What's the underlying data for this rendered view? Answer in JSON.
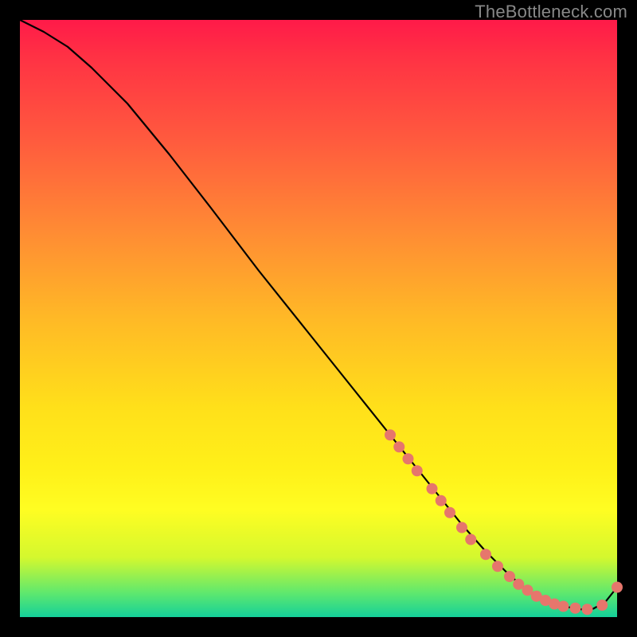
{
  "watermark": "TheBottleneck.com",
  "colors": {
    "background": "#000000",
    "curve_stroke": "#000000",
    "marker_fill": "#e6766c",
    "marker_stroke": "#d85e56",
    "gradient_top": "#ff1a49",
    "gradient_mid1": "#ffb926",
    "gradient_mid2": "#fffd22",
    "gradient_bottom": "#14d09a"
  },
  "chart_data": {
    "type": "line",
    "title": "",
    "xlabel": "",
    "ylabel": "",
    "xlim": [
      0,
      100
    ],
    "ylim": [
      0,
      100
    ],
    "grid": false,
    "legend": false,
    "series": [
      {
        "name": "bottleneck-curve",
        "x": [
          0,
          4,
          8,
          12,
          18,
          25,
          32,
          40,
          48,
          56,
          62,
          66,
          70,
          74,
          78,
          82,
          85,
          88,
          91,
          94,
          96,
          98,
          100
        ],
        "y": [
          100,
          98,
          95.5,
          92,
          86,
          77.5,
          68.5,
          58,
          48,
          38,
          30.5,
          25.5,
          20.5,
          15.5,
          11,
          7,
          4.5,
          2.8,
          1.8,
          1.3,
          1.4,
          2.5,
          5
        ]
      }
    ],
    "markers": [
      {
        "x": 62,
        "y": 30.5
      },
      {
        "x": 63.5,
        "y": 28.5
      },
      {
        "x": 65,
        "y": 26.5
      },
      {
        "x": 66.5,
        "y": 24.5
      },
      {
        "x": 69,
        "y": 21.5
      },
      {
        "x": 70.5,
        "y": 19.5
      },
      {
        "x": 72,
        "y": 17.5
      },
      {
        "x": 74,
        "y": 15
      },
      {
        "x": 75.5,
        "y": 13
      },
      {
        "x": 78,
        "y": 10.5
      },
      {
        "x": 80,
        "y": 8.5
      },
      {
        "x": 82,
        "y": 6.8
      },
      {
        "x": 83.5,
        "y": 5.5
      },
      {
        "x": 85,
        "y": 4.5
      },
      {
        "x": 86.5,
        "y": 3.5
      },
      {
        "x": 88,
        "y": 2.8
      },
      {
        "x": 89.5,
        "y": 2.2
      },
      {
        "x": 91,
        "y": 1.8
      },
      {
        "x": 93,
        "y": 1.5
      },
      {
        "x": 95,
        "y": 1.3
      },
      {
        "x": 97.5,
        "y": 2.0
      },
      {
        "x": 100,
        "y": 5
      }
    ]
  }
}
